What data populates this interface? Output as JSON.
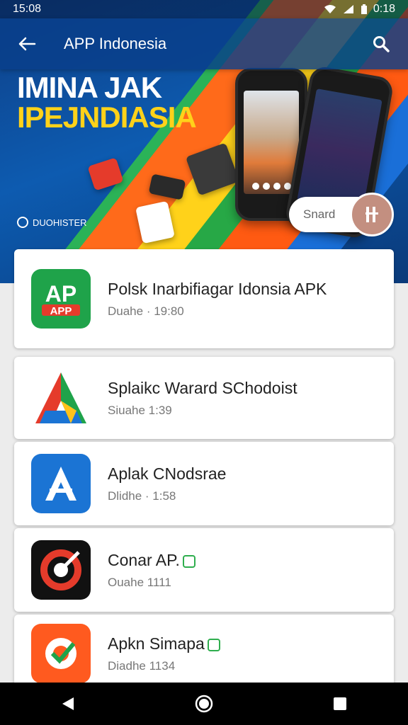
{
  "status": {
    "time": "15:08",
    "right_time": "0:18"
  },
  "appbar": {
    "title": "APP Indonesia"
  },
  "hero": {
    "line1": "IMINA JAK",
    "line2": "IPEJNDIASIA",
    "brand": "DUOHISTER",
    "share_label": "Snard"
  },
  "apps": [
    {
      "name": "Polsk Inarbifiagar Idonsia APK",
      "sub": "Duahe · 19:80",
      "icon": "green-app-logo",
      "color": "#1fa34a"
    },
    {
      "name": "Splaikc Warard SChodoist",
      "sub": "Siuahe  1:39",
      "icon": "tri-color-a-logo",
      "color": "#ffffff"
    },
    {
      "name": "Aplak CNodsrae",
      "sub": "Dlidhe · 1:58",
      "icon": "blue-a-logo",
      "color": "#1b74d4"
    },
    {
      "name": "Conar AP.",
      "sub": "Ouahe  1111",
      "icon": "red-target-logo",
      "color": "#111111"
    },
    {
      "name": "Apkn Simapa",
      "sub": "Diadhe  1134",
      "icon": "orange-gear-logo",
      "color": "#ff5a1f"
    }
  ],
  "nav": {
    "back": "back-icon",
    "home": "home-icon",
    "recents": "recents-icon"
  }
}
